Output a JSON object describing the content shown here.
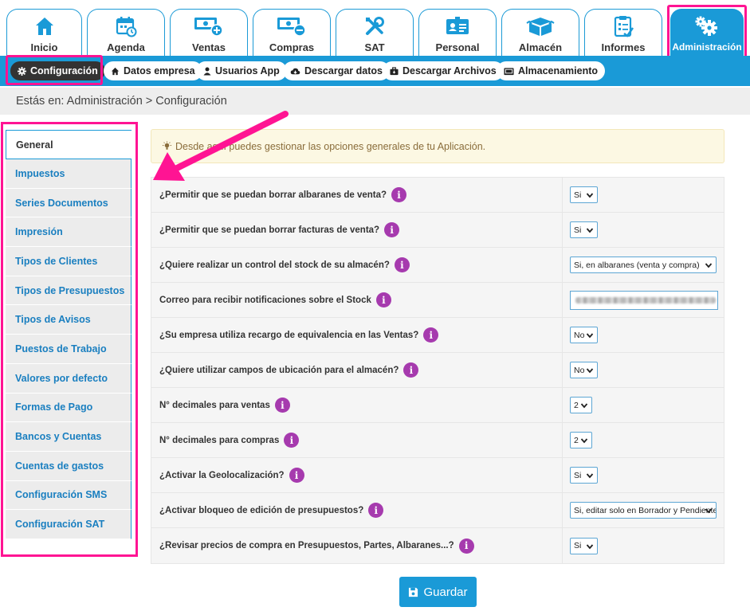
{
  "tabs": [
    {
      "label": "Inicio",
      "icon": "home-icon"
    },
    {
      "label": "Agenda",
      "icon": "calendar-icon"
    },
    {
      "label": "Ventas",
      "icon": "cash-plus-icon"
    },
    {
      "label": "Compras",
      "icon": "cash-minus-icon"
    },
    {
      "label": "SAT",
      "icon": "tools-icon"
    },
    {
      "label": "Personal",
      "icon": "id-card-icon"
    },
    {
      "label": "Almacén",
      "icon": "boxes-icon"
    },
    {
      "label": "Informes",
      "icon": "clipboard-icon"
    },
    {
      "label": "Administración",
      "icon": "gears-icon"
    }
  ],
  "subnav": [
    {
      "label": "Configuración",
      "icon": "gear-icon"
    },
    {
      "label": "Datos empresa",
      "icon": "home-icon"
    },
    {
      "label": "Usuarios App",
      "icon": "user-icon"
    },
    {
      "label": "Descargar datos",
      "icon": "cloud-download-icon"
    },
    {
      "label": "Descargar Archivos",
      "icon": "briefcase-icon"
    },
    {
      "label": "Almacenamiento",
      "icon": "folder-icon"
    }
  ],
  "breadcrumb": "Estás en: Administración > Configuración",
  "sidebar": [
    "General",
    "Impuestos",
    "Series Documentos",
    "Impresión",
    "Tipos de Clientes",
    "Tipos de Presupuestos",
    "Tipos de Avisos",
    "Puestos de Trabajo",
    "Valores por defecto",
    "Formas de Pago",
    "Bancos y Cuentas",
    "Cuentas de gastos",
    "Configuración SMS",
    "Configuración SAT"
  ],
  "info_text": "Desde aquí puedes gestionar las opciones generales de tu Aplicación.",
  "settings": [
    {
      "q": "¿Permitir que se puedan borrar albaranes de venta?",
      "value": "Si"
    },
    {
      "q": "¿Permitir que se puedan borrar facturas de venta?",
      "value": "Si"
    },
    {
      "q": "¿Quiere realizar un control del stock de su almacén?",
      "value": "Si, en albaranes (venta y compra)"
    },
    {
      "q": "Correo para recibir notificaciones sobre el Stock",
      "value": ""
    },
    {
      "q": "¿Su empresa utiliza recargo de equivalencia en las Ventas?",
      "value": "No"
    },
    {
      "q": "¿Quiere utilizar campos de ubicación para el almacén?",
      "value": "No"
    },
    {
      "q": "N° decimales para ventas",
      "value": "2"
    },
    {
      "q": "N° decimales para compras",
      "value": "2"
    },
    {
      "q": "¿Activar la Geolocalización?",
      "value": "Si"
    },
    {
      "q": "¿Activar bloqueo de edición de presupuestos?",
      "value": "Si, editar solo en Borrador y Pendiente"
    },
    {
      "q": "¿Revisar precios de compra en Presupuestos, Partes, Albaranes...?",
      "value": "Si"
    }
  ],
  "info_icon_glyph": "i",
  "save_label": "Guardar",
  "colors": {
    "brand": "#1a9ad7",
    "highlight": "#ff1493",
    "info_dot": "#a63aae"
  }
}
